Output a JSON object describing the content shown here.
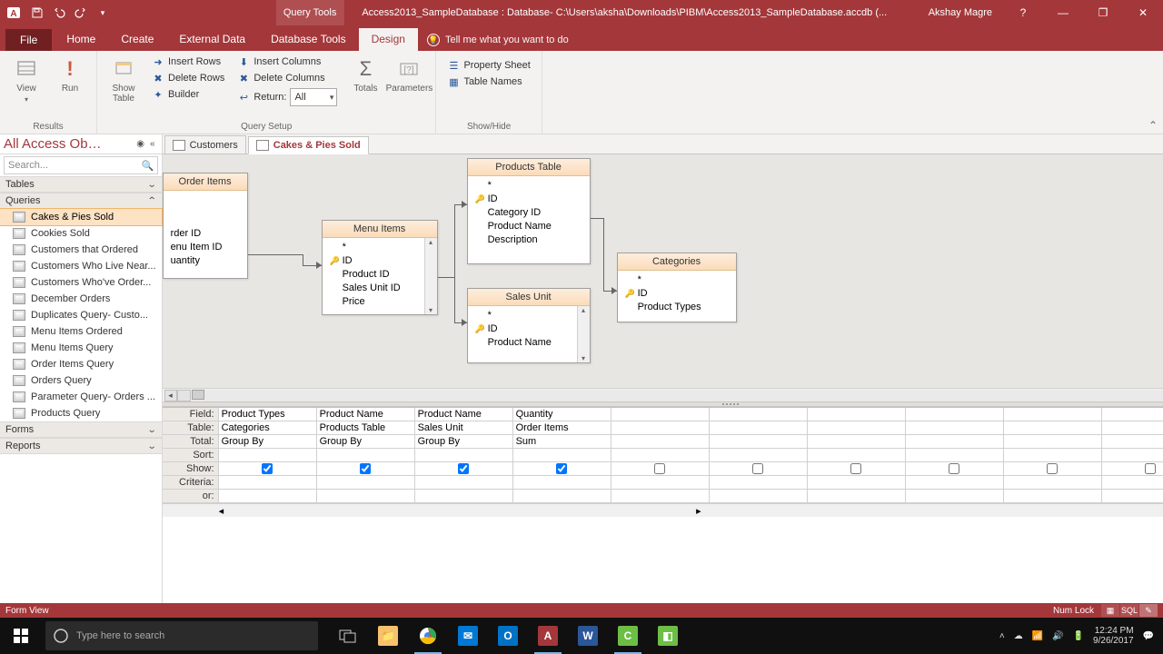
{
  "titlebar": {
    "context_tab": "Query Tools",
    "title": "Access2013_SampleDatabase : Database- C:\\Users\\aksha\\Downloads\\PIBM\\Access2013_SampleDatabase.accdb (...",
    "user": "Akshay Magre"
  },
  "tabs": {
    "file": "File",
    "items": [
      "Home",
      "Create",
      "External Data",
      "Database Tools",
      "Design"
    ],
    "active": "Design",
    "tellme": "Tell me what you want to do"
  },
  "ribbon": {
    "results": {
      "label": "Results",
      "view": "View",
      "run": "Run"
    },
    "query_type": {
      "show_table": "Show\nTable"
    },
    "query_setup": {
      "label": "Query Setup",
      "insert_rows": "Insert Rows",
      "delete_rows": "Delete Rows",
      "builder": "Builder",
      "insert_cols": "Insert Columns",
      "delete_cols": "Delete Columns",
      "return": "Return:",
      "return_val": "All",
      "totals": "Totals",
      "parameters": "Parameters"
    },
    "showhide": {
      "label": "Show/Hide",
      "property_sheet": "Property Sheet",
      "table_names": "Table Names"
    }
  },
  "nav": {
    "title": "All Access Ob…",
    "search_placeholder": "Search...",
    "groups": {
      "tables": "Tables",
      "queries": "Queries",
      "forms": "Forms",
      "reports": "Reports"
    },
    "queries": [
      "Cakes & Pies Sold",
      "Cookies Sold",
      "Customers that Ordered",
      "Customers Who Live Near...",
      "Customers Who've Order...",
      "December Orders",
      "Duplicates Query- Custo...",
      "Menu Items Ordered",
      "Menu Items Query",
      "Order Items Query",
      "Orders Query",
      "Parameter Query- Orders ...",
      "Products Query"
    ],
    "selected_query": "Cakes & Pies Sold"
  },
  "doc_tabs": {
    "items": [
      {
        "label": "Customers",
        "active": false
      },
      {
        "label": "Cakes & Pies Sold",
        "active": true
      }
    ]
  },
  "design": {
    "order_items": {
      "title": "Order Items",
      "fields": [
        "rder ID",
        "enu Item ID",
        "uantity"
      ]
    },
    "menu_items": {
      "title": "Menu Items",
      "fields": [
        "*",
        "ID",
        "Product ID",
        "Sales Unit ID",
        "Price"
      ]
    },
    "products": {
      "title": "Products Table",
      "fields": [
        "*",
        "ID",
        "Category ID",
        "Product Name",
        "Description"
      ]
    },
    "sales_unit": {
      "title": "Sales Unit",
      "fields": [
        "*",
        "ID",
        "Product Name"
      ]
    },
    "categories": {
      "title": "Categories",
      "fields": [
        "*",
        "ID",
        "Product Types"
      ]
    }
  },
  "qbe": {
    "row_labels": {
      "field": "Field:",
      "table": "Table:",
      "total": "Total:",
      "sort": "Sort:",
      "show": "Show:",
      "criteria": "Criteria:",
      "or": "or:"
    },
    "cols": [
      {
        "field": "Product Types",
        "table": "Categories",
        "total": "Group By",
        "show": true
      },
      {
        "field": "Product Name",
        "table": "Products Table",
        "total": "Group By",
        "show": true
      },
      {
        "field": "Product Name",
        "table": "Sales Unit",
        "total": "Group By",
        "show": true
      },
      {
        "field": "Quantity",
        "table": "Order Items",
        "total": "Sum",
        "show": true
      },
      {
        "field": "",
        "table": "",
        "total": "",
        "show": false
      },
      {
        "field": "",
        "table": "",
        "total": "",
        "show": false
      },
      {
        "field": "",
        "table": "",
        "total": "",
        "show": false
      },
      {
        "field": "",
        "table": "",
        "total": "",
        "show": false
      },
      {
        "field": "",
        "table": "",
        "total": "",
        "show": false
      },
      {
        "field": "",
        "table": "",
        "total": "",
        "show": false
      },
      {
        "field": "",
        "table": "",
        "total": "",
        "show": false
      }
    ]
  },
  "statusbar": {
    "left": "Form View",
    "numlock": "Num Lock",
    "sql": "SQL"
  },
  "taskbar": {
    "search_placeholder": "Type here to search",
    "time": "12:24 PM",
    "date": "9/26/2017"
  }
}
